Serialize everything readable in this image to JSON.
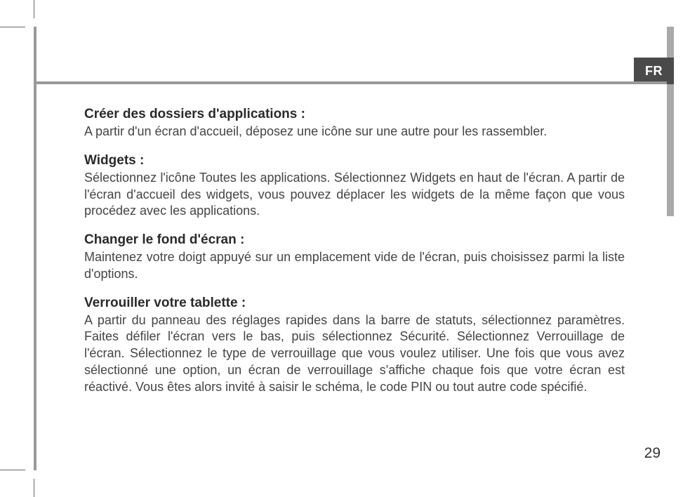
{
  "lang_tab": "FR",
  "page_number": "29",
  "sections": [
    {
      "heading": "Créer des dossiers d'applications :",
      "body": "A partir d'un écran d'accueil, déposez une icône sur une autre pour les rassembler."
    },
    {
      "heading": "Widgets :",
      "body": "Sélectionnez l'icône Toutes les applications. Sélectionnez Widgets en haut de l'écran. A partir de l'écran d'accueil des widgets, vous pouvez déplacer les widgets de la même façon que vous procédez avec les applications."
    },
    {
      "heading": "Changer le fond d'écran :",
      "body": "Maintenez votre doigt appuyé sur un emplacement vide de l'écran, puis choisissez parmi la liste d'options."
    },
    {
      "heading": "Verrouiller votre tablette :",
      "body": "A partir du panneau des réglages rapides dans la barre de statuts, sélectionnez paramètres.  Faites défiler l'écran vers le bas, puis sélectionnez Sécurité. Sélectionnez Verrouillage de l'écran. Sélectionnez le type de verrouillage que vous voulez utiliser. Une fois que vous avez sélectionné une option, un écran de verrouillage s'affiche chaque fois que votre écran est réactivé. Vous êtes alors invité à saisir le schéma, le code PIN ou tout autre code spécifié."
    }
  ]
}
